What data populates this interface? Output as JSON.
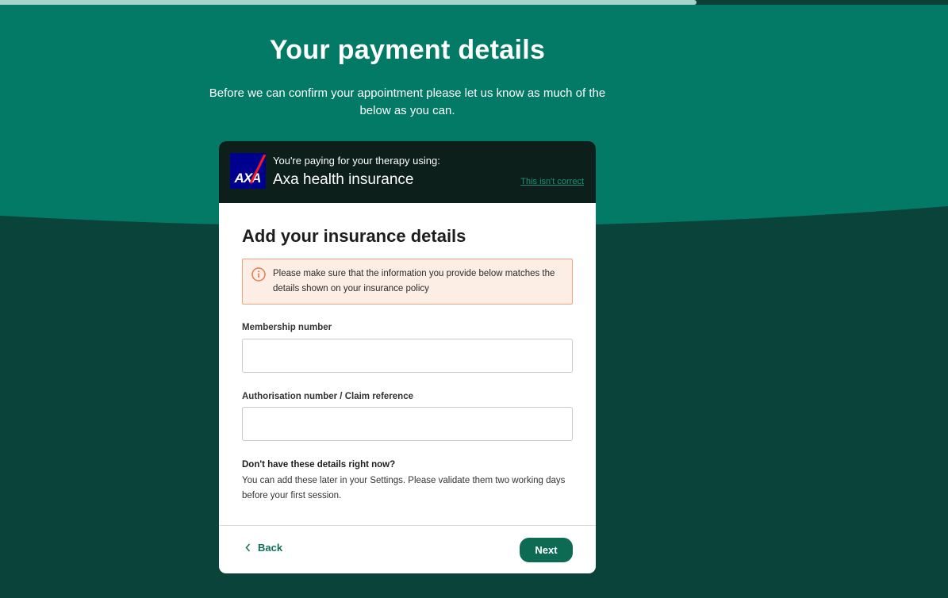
{
  "progress": {
    "fraction": 0.735
  },
  "colors": {
    "top_background": "#027a66",
    "bottom_background": "#0a4339",
    "accent": "#0d6b54",
    "alert_border": "#f1a47f",
    "alert_icon": "#e8794d"
  },
  "header": {
    "title": "Your payment details",
    "subtitle": "Before we can confirm your appointment please let us know as much of the below as you can."
  },
  "payer": {
    "caption": "You're paying for your therapy using:",
    "provider": "Axa health insurance",
    "logo_text": "AXA",
    "not_correct_link": "This isn't correct"
  },
  "form": {
    "title": "Add your insurance details",
    "alert": {
      "icon": "info-icon",
      "text": "Please make sure that the information you provide below matches the details shown on your insurance policy"
    },
    "fields": [
      {
        "label": "Membership number",
        "value": "",
        "placeholder": ""
      },
      {
        "label": "Authorisation number / Claim reference",
        "value": "",
        "placeholder": ""
      }
    ],
    "help": {
      "title": "Don't have these details right now?",
      "text": "You can add these later in your Settings. Please validate them two working days before your first session."
    }
  },
  "footer": {
    "back_label": "Back",
    "back_icon": "chevron-left-icon",
    "next_label": "Next"
  }
}
